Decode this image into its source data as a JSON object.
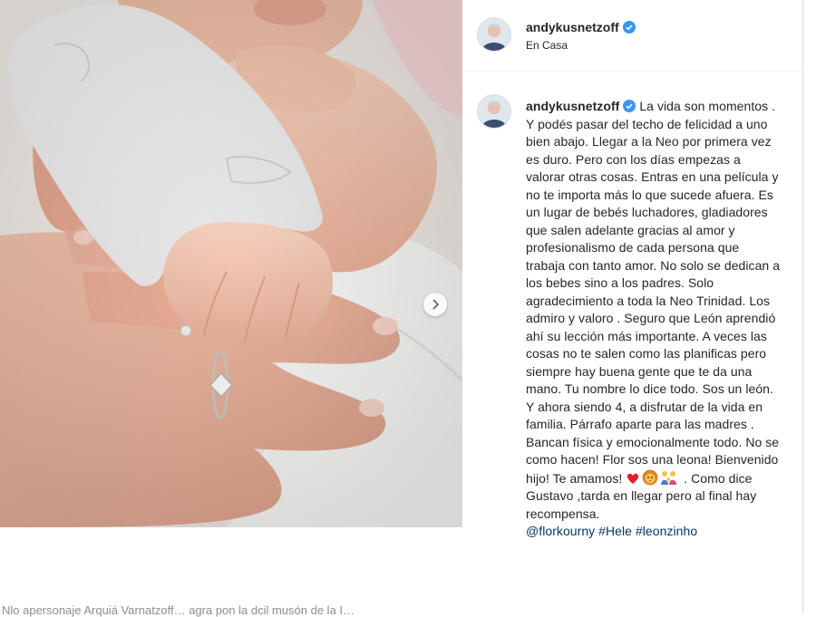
{
  "post": {
    "username": "andykusnetzoff",
    "location": "En Casa",
    "caption_username": "andykusnetzoff",
    "caption_text": " La vida son momentos . Y podés pasar del techo de felicidad a uno bien abajo. Llegar a la Neo por primera vez es duro. Pero con los días empezas a valorar otras cosas. Entras en una película y no te importa más lo que sucede afuera. Es un lugar de bebés luchadores, gladiadores que salen adelante gracias al amor y profesionalismo de cada persona que trabaja con tanto amor. No solo se dedican a los bebes sino a los padres. Solo agradecimiento a toda la Neo Trinidad. Los admiro y valoro . Seguro que León aprendió ahí su lección más importante. A veces las cosas no te salen como las planificas pero siempre hay buena gente que te da una mano. Tu nombre lo dice todo. Sos un león. Y ahora siendo 4, a disfrutar de la vida en familia. Párrafo aparte para las madres . Bancan física y emocionalmente todo. No se como hacen! Flor sos una leona! Bienvenido hijo! Te amamos! ",
    "caption_end": " . Como dice Gustavo ,tarda en llegar pero al final hay recompensa.",
    "hashtags": "@florkourny #Hele #leonzinho",
    "emojis": [
      "red-heart",
      "lion-face",
      "family"
    ]
  },
  "cut_text": "Nlo apersonaje Arquiá Varnatzoff… agra pon la dcil musón de la I…",
  "icons": {
    "verified": "verified-badge-icon",
    "carousel": "chevron-right-icon"
  },
  "colors": {
    "verified_blue": "#3897f0",
    "hashtag_blue": "#00376b",
    "border": "#dbdbdb"
  }
}
